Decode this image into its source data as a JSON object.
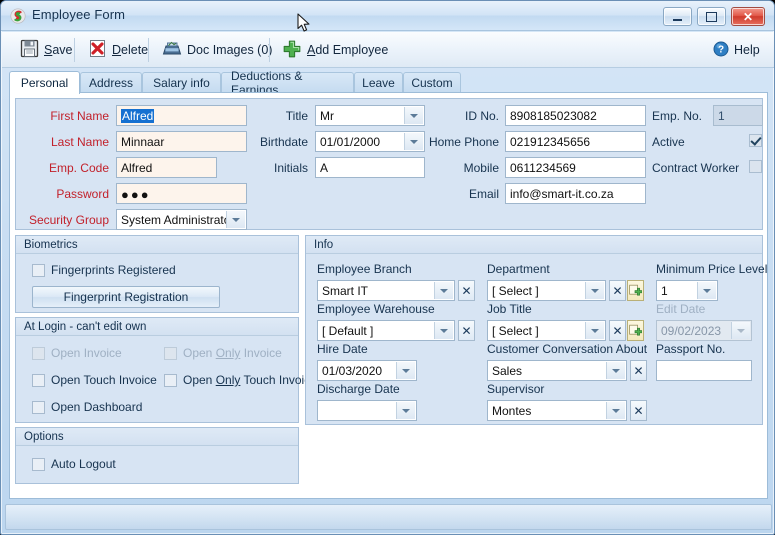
{
  "window": {
    "title": "Employee Form",
    "icon": "app-logo-icon",
    "minimize_label": "Minimize",
    "maximize_label": "Maximize",
    "close_label": "Close"
  },
  "toolbar": {
    "save_label": "Save",
    "delete_label": "Delete",
    "doc_images_label": "Doc Images (0)",
    "add_employee_label": "Add Employee",
    "help_label": "Help"
  },
  "tabs": [
    {
      "label": "Personal",
      "active": true
    },
    {
      "label": "Address",
      "active": false
    },
    {
      "label": "Salary info",
      "active": false
    },
    {
      "label": "Deductions & Earnings",
      "active": false
    },
    {
      "label": "Leave",
      "active": false
    },
    {
      "label": "Custom",
      "active": false
    }
  ],
  "personal": {
    "first_name_label": "First Name",
    "first_name_value": "Alfred",
    "last_name_label": "Last Name",
    "last_name_value": "Minnaar",
    "emp_code_label": "Emp. Code",
    "emp_code_value": "Alfred",
    "password_label": "Password",
    "password_value": "●●●",
    "security_group_label": "Security Group",
    "security_group_value": "System Administrator",
    "title_label": "Title",
    "title_value": "Mr",
    "birthdate_label": "Birthdate",
    "birthdate_value": "01/01/2000",
    "initials_label": "Initials",
    "initials_value": "A",
    "id_no_label": "ID No.",
    "id_no_value": "8908185023082",
    "home_phone_label": "Home Phone",
    "home_phone_value": "021912345656",
    "mobile_label": "Mobile",
    "mobile_value": "0611234569",
    "email_label": "Email",
    "email_value": "info@smart-it.co.za",
    "emp_no_label": "Emp. No.",
    "emp_no_value": "1",
    "active_label": "Active",
    "contract_worker_label": "Contract Worker"
  },
  "biometrics": {
    "title": "Biometrics",
    "fingerprints_registered_label": "Fingerprints Registered",
    "fingerprint_registration_button": "Fingerprint Registration"
  },
  "at_login": {
    "title": "At Login - can't edit own",
    "open_invoice_label": "Open Invoice",
    "open_only_invoice_label": "Open Only Invoice",
    "open_touch_invoice_label": "Open Touch Invoice",
    "open_only_touch_invoice_label": "Open Only Touch Invoice",
    "open_dashboard_label": "Open Dashboard"
  },
  "options": {
    "title": "Options",
    "auto_logout_label": "Auto Logout"
  },
  "info": {
    "title": "Info",
    "employee_branch_label": "Employee Branch",
    "employee_branch_value": "Smart IT",
    "employee_warehouse_label": "Employee Warehouse",
    "employee_warehouse_value": "[ Default ]",
    "hire_date_label": "Hire Date",
    "hire_date_value": "01/03/2020",
    "discharge_date_label": "Discharge Date",
    "discharge_date_value": "",
    "department_label": "Department",
    "department_value": "[ Select ]",
    "job_title_label": "Job Title",
    "job_title_value": "[ Select ]",
    "customer_conversation_label": "Customer Conversation About",
    "customer_conversation_value": "Sales",
    "supervisor_label": "Supervisor",
    "supervisor_value": "Montes",
    "minimum_price_level_label": "Minimum Price Level",
    "minimum_price_level_value": "1",
    "edit_date_label": "Edit Date",
    "edit_date_value": "09/02/2023",
    "passport_no_label": "Passport No.",
    "passport_no_value": "",
    "clear_button_glyph": "✕",
    "add_button_glyph": "+"
  },
  "colors": {
    "required_label": "#c2212b",
    "panel_bg": "#d7e4f3",
    "field_bg": "#fdf4ec",
    "accent_blue": "#1570d1",
    "close_red": "#cf3b2c"
  }
}
